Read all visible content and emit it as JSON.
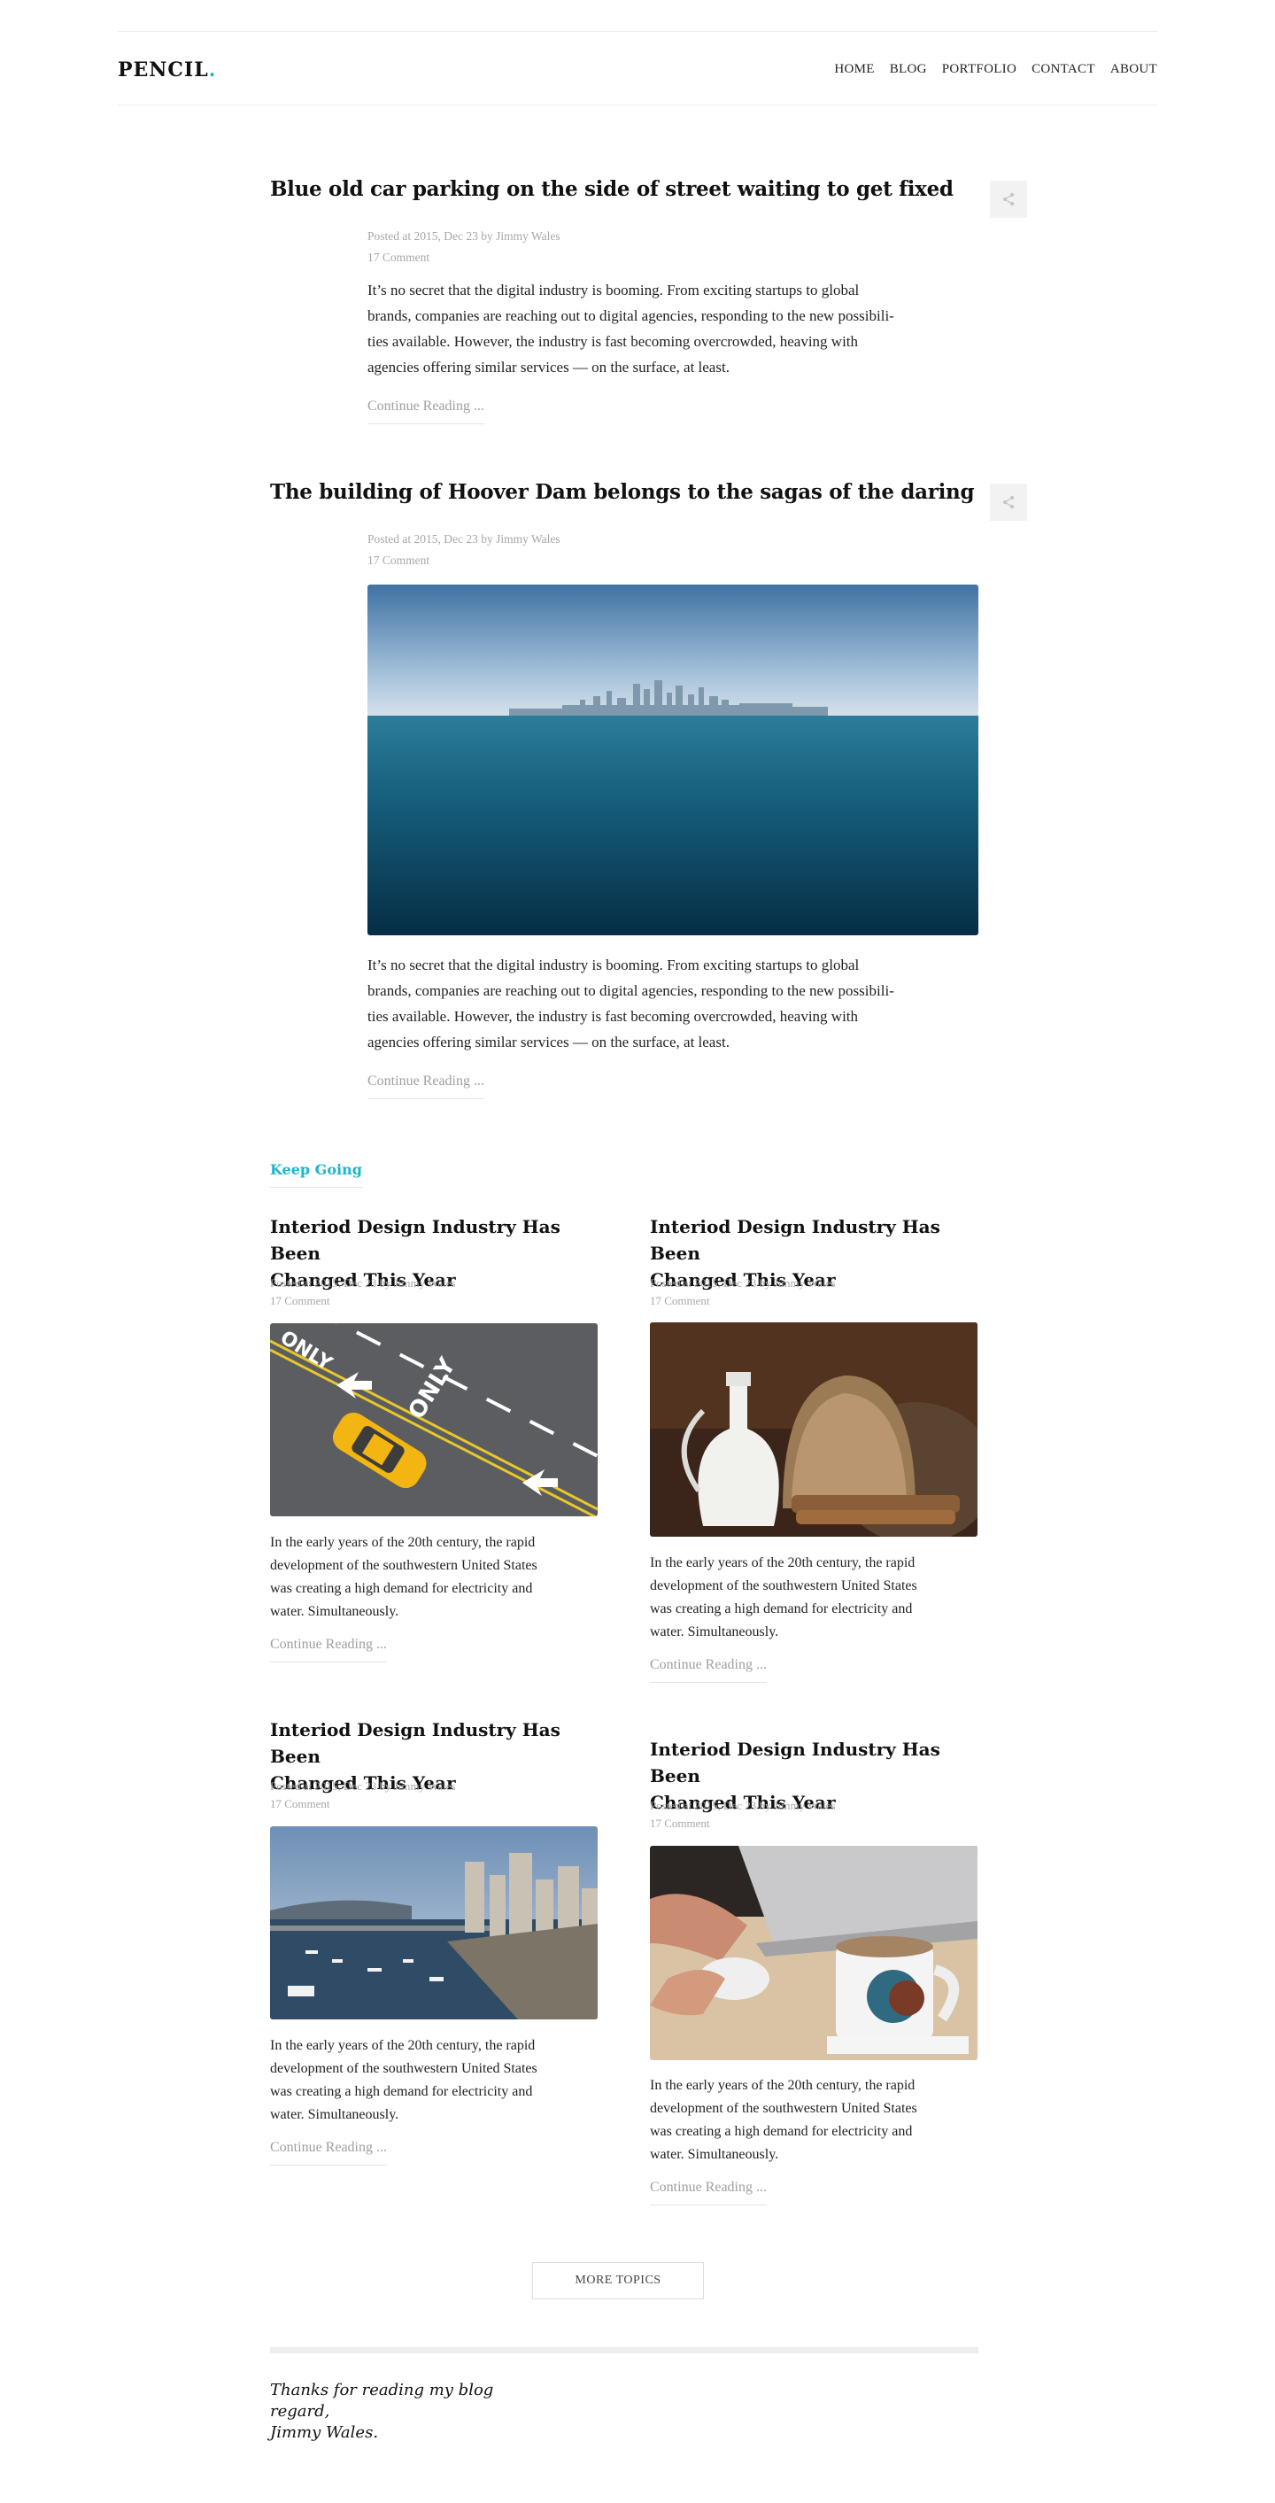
{
  "header": {
    "logo_text": "PENCIL",
    "logo_dot": ".",
    "nav": [
      "HOME",
      "BLOG",
      "PORTFOLIO",
      "CONTACT",
      "ABOUT"
    ]
  },
  "posts": [
    {
      "title": "Blue old car parking on the side of street waiting to get fixed",
      "meta_posted": "Posted at 2015, Dec 23 by Jimmy Wales",
      "meta_comments": "17 Comment",
      "excerpt_lines": [
        "It’s no secret that the digital industry is booming. From exciting startups to global",
        "brands, companies are reaching out to digital agencies, responding to the new possibili-",
        "ties available. However, the industry is fast becoming overcrowded, heaving with",
        "agencies offering similar services — on the surface, at least."
      ],
      "continue": "Continue Reading ..."
    },
    {
      "title": "The building of Hoover Dam belongs to the sagas of the daring",
      "meta_posted": "Posted at 2015, Dec 23 by Jimmy Wales",
      "meta_comments": "17 Comment",
      "excerpt_lines": [
        "It’s no secret that the digital industry is booming. From exciting startups to global",
        "brands, companies are reaching out to digital agencies, responding to the new possibili-",
        "ties available. However, the industry is fast becoming overcrowded, heaving with",
        "agencies offering similar services — on the surface, at least."
      ],
      "continue": "Continue Reading ..."
    }
  ],
  "keep_going": "Keep Going",
  "cards": [
    {
      "title_lines": [
        "Interiod Design Industry Has Been",
        "Changed This Year"
      ],
      "meta_posted": "Posted at 2015, Dec 23 by Jimmy Wales",
      "meta_comments": "17 Comment",
      "text_lines": [
        "In the early years of the 20th century, the rapid",
        "development of the southwestern United States",
        "was creating a high demand for electricity and",
        "water. Simultaneously."
      ],
      "continue": "Continue Reading ..."
    },
    {
      "title_lines": [
        "Interiod Design Industry Has Been",
        "Changed This Year"
      ],
      "meta_posted": "Posted at 2015, Dec 23 by Jimmy Wales",
      "meta_comments": "17 Comment",
      "text_lines": [
        "In the early years of the 20th century, the rapid",
        "development of the southwestern United States",
        "was creating a high demand for electricity and",
        "water. Simultaneously."
      ],
      "continue": "Continue Reading ..."
    },
    {
      "title_lines": [
        "Interiod Design Industry Has Been",
        "Changed This Year"
      ],
      "meta_posted": "Posted at 2015, Dec 23 by Jimmy Wales",
      "meta_comments": "17 Comment",
      "text_lines": [
        "In the early years of the 20th century, the rapid",
        "development of the southwestern United States",
        "was creating a high demand for electricity and",
        "water. Simultaneously."
      ],
      "continue": "Continue Reading ..."
    },
    {
      "title_lines": [
        "Interiod Design Industry Has Been",
        "Changed This Year"
      ],
      "meta_posted": "Posted at 2015, Dec 23 by Jimmy Wales",
      "meta_comments": "17 Comment",
      "text_lines": [
        "In the early years of the 20th century, the rapid",
        "development of the southwestern United States",
        "was creating a high demand for electricity and",
        "water. Simultaneously."
      ],
      "continue": "Continue Reading ..."
    }
  ],
  "more_topics": "MORE TOPICS",
  "signature_lines": [
    "Thanks for reading my blog",
    "regard,",
    "Jimmy Wales."
  ],
  "colors": {
    "accent": "#1cb4d0",
    "meta": "#a8a8a8",
    "text": "#222222"
  },
  "icons": {
    "share": "share-icon"
  }
}
